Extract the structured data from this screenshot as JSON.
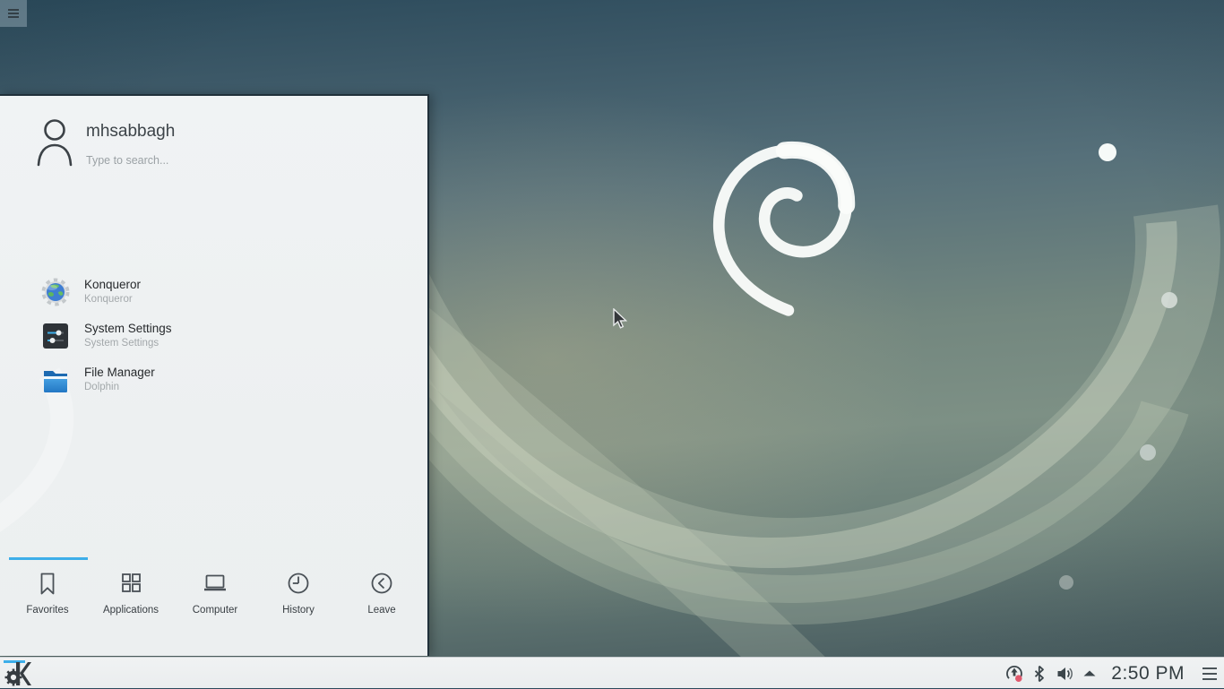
{
  "desktop": {
    "wallpaper": "debian-joy-wallpaper",
    "toolbox_icon": "hamburger-icon",
    "accent_color": "#3daee9",
    "swirl_color": "#ffffff"
  },
  "launcher": {
    "user": {
      "name": "mhsabbagh",
      "avatar_icon": "user-outline-icon"
    },
    "search": {
      "placeholder": "Type to search..."
    },
    "apps": [
      {
        "title": "Konqueror",
        "subtitle": "Konqueror",
        "icon": "konqueror-globe-icon"
      },
      {
        "title": "System Settings",
        "subtitle": "System Settings",
        "icon": "system-settings-sliders-icon"
      },
      {
        "title": "File Manager",
        "subtitle": "Dolphin",
        "icon": "blue-folder-icon"
      }
    ],
    "tabs": [
      {
        "label": "Favorites",
        "icon": "bookmark-icon",
        "active": true
      },
      {
        "label": "Applications",
        "icon": "app-grid-icon",
        "active": false
      },
      {
        "label": "Computer",
        "icon": "laptop-icon",
        "active": false
      },
      {
        "label": "History",
        "icon": "clock-icon",
        "active": false
      },
      {
        "label": "Leave",
        "icon": "leave-back-icon",
        "active": false
      }
    ]
  },
  "taskbar": {
    "launcher_icon": "kde-logo-icon",
    "tray": [
      {
        "name": "software-updates-icon",
        "badge_color": "#e05a6e"
      },
      {
        "name": "bluetooth-icon"
      },
      {
        "name": "volume-icon"
      },
      {
        "name": "expand-tray-arrow-icon"
      }
    ],
    "clock": "2:50 PM",
    "menu_icon": "hamburger-icon"
  }
}
